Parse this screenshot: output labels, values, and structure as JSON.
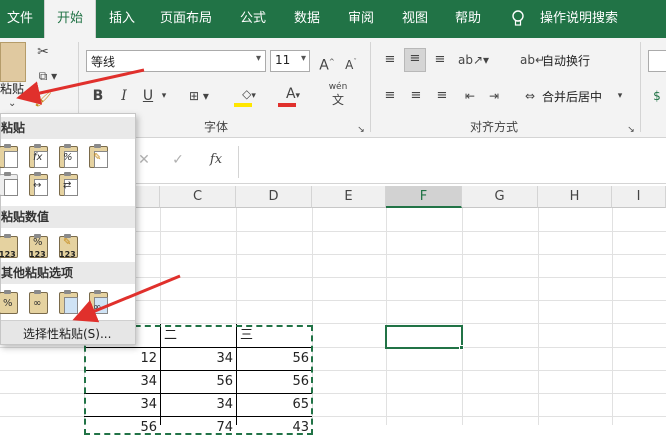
{
  "tabs": [
    "文件",
    "开始",
    "插入",
    "页面布局",
    "公式",
    "数据",
    "审阅",
    "视图",
    "帮助"
  ],
  "tell_me": "操作说明搜索",
  "ribbon": {
    "paste_label": "粘贴",
    "font_name": "等线",
    "font_size": "11",
    "bold": "B",
    "italic": "I",
    "underline": "U",
    "font_group": "字体",
    "wrap_text": "自动换行",
    "merge_center": "合并后居中",
    "align_group": "对齐方式",
    "wen_top": "wén",
    "wen_bottom": "文"
  },
  "formula_bar": {
    "fx": "fx"
  },
  "columns": [
    "C",
    "D",
    "E",
    "F",
    "G",
    "H",
    "I"
  ],
  "cells": {
    "header_2": "二",
    "header_3": "三",
    "rows": [
      [
        "12",
        "34",
        "56"
      ],
      [
        "34",
        "56",
        "56"
      ],
      [
        "34",
        "34",
        "65"
      ],
      [
        "56",
        "74",
        "43"
      ]
    ]
  },
  "paste_menu": {
    "section_paste": "粘贴",
    "section_values": "粘贴数值",
    "section_other": "其他粘贴选项",
    "paste_special": "选择性粘贴(S)..."
  },
  "colors": {
    "accent": "#217346",
    "arrow": "#e0302c"
  }
}
